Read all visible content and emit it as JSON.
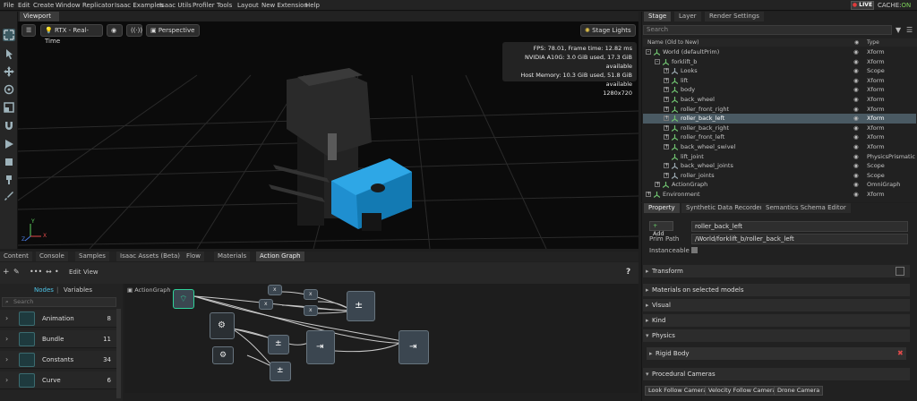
{
  "menu": [
    "File",
    "Edit",
    "Create",
    "Window",
    "Replicator",
    "Isaac Examples",
    "Isaac Utils",
    "Profiler",
    "Tools",
    "Layout",
    "New Extension",
    "Help"
  ],
  "live": {
    "label": "LIVE"
  },
  "cache": {
    "label": "CACHE:",
    "status": "ON"
  },
  "viewport": {
    "tab": "Viewport",
    "renderer": "RTX - Real-Time",
    "camera": "Perspective",
    "lights": "Stage Lights",
    "stats": [
      "FPS: 78.01, Frame time: 12.82 ms",
      "NVIDIA A10G: 3.0 GiB used, 17.3 GiB available",
      "Host Memory: 10.3 GiB used, 51.8 GiB available",
      "1280x720"
    ],
    "axis": {
      "x": "X",
      "y": "Y",
      "z": "Z"
    }
  },
  "stage": {
    "tabs": [
      "Stage",
      "Layer",
      "Render Settings"
    ],
    "search_placeholder": "Search",
    "col_name": "Name (Old to New)",
    "col_type": "Type",
    "rows": [
      {
        "name": "World (defaultPrim)",
        "type": "Xform",
        "depth": 0,
        "exp": "-"
      },
      {
        "name": "forklift_b",
        "type": "Xform",
        "depth": 1,
        "exp": "-"
      },
      {
        "name": "Looks",
        "type": "Scope",
        "depth": 2,
        "exp": "+"
      },
      {
        "name": "lift",
        "type": "Xform",
        "depth": 2,
        "exp": "+"
      },
      {
        "name": "body",
        "type": "Xform",
        "depth": 2,
        "exp": "+"
      },
      {
        "name": "back_wheel",
        "type": "Xform",
        "depth": 2,
        "exp": "+"
      },
      {
        "name": "roller_front_right",
        "type": "Xform",
        "depth": 2,
        "exp": "+"
      },
      {
        "name": "roller_back_left",
        "type": "Xform",
        "depth": 2,
        "exp": "+",
        "selected": true
      },
      {
        "name": "roller_back_right",
        "type": "Xform",
        "depth": 2,
        "exp": "+"
      },
      {
        "name": "roller_front_left",
        "type": "Xform",
        "depth": 2,
        "exp": "+"
      },
      {
        "name": "back_wheel_swivel",
        "type": "Xform",
        "depth": 2,
        "exp": "+"
      },
      {
        "name": "lift_joint",
        "type": "PhysicsPrismatic",
        "depth": 2,
        "exp": ""
      },
      {
        "name": "back_wheel_joints",
        "type": "Scope",
        "depth": 2,
        "exp": "+"
      },
      {
        "name": "roller_joints",
        "type": "Scope",
        "depth": 2,
        "exp": "+"
      },
      {
        "name": "ActionGraph",
        "type": "OmniGraph",
        "depth": 1,
        "exp": "+"
      },
      {
        "name": "Environment",
        "type": "Xform",
        "depth": 0,
        "exp": "+"
      }
    ]
  },
  "property": {
    "tabs": [
      "Property",
      "Synthetic Data Recorder",
      "Semantics Schema Editor"
    ],
    "add": "Add",
    "name_value": "roller_back_left",
    "prim_path_label": "Prim Path",
    "prim_path_value": "/World/forklift_b/roller_back_left",
    "instanceable_label": "Instanceable",
    "sections": [
      "Transform",
      "Materials on selected models",
      "Visual",
      "Kind",
      "Physics"
    ],
    "rigid_body": "Rigid Body",
    "procedural": "Procedural Cameras",
    "camera_buttons": [
      "Look Follow Camera",
      "Velocity Follow Camera",
      "Drone Camera"
    ]
  },
  "bottom": {
    "tabs": [
      "Content",
      "Console",
      "Samples",
      "Isaac Assets (Beta)",
      "Flow",
      "Materials",
      "Action Graph"
    ],
    "edit": "Edit",
    "view": "View",
    "help": "?",
    "nodes_tab": "Nodes",
    "variables_tab": "Variables",
    "search_placeholder": "Search",
    "categories": [
      {
        "name": "Animation",
        "count": "8"
      },
      {
        "name": "Bundle",
        "count": "11"
      },
      {
        "name": "Constants",
        "count": "34"
      },
      {
        "name": "Curve",
        "count": "6"
      }
    ],
    "graph_label": "ActionGraph"
  }
}
